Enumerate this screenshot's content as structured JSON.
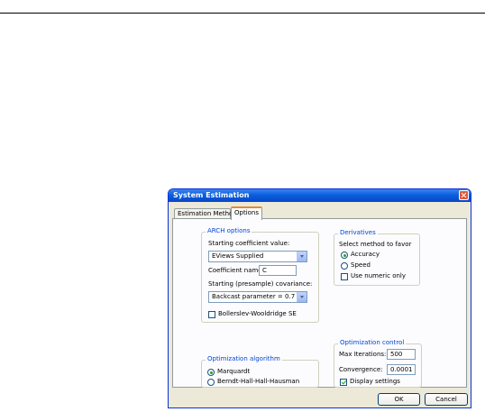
{
  "window": {
    "title": "System Estimation"
  },
  "tabs": [
    {
      "label": "Estimation Method"
    },
    {
      "label": "Options"
    }
  ],
  "arch": {
    "legend": "ARCH options",
    "start_coef_label": "Starting coefficient value:",
    "start_coef_value": "EViews Supplied",
    "coef_name_label": "Coefficient name:",
    "coef_name_value": "C",
    "start_cov_label": "Starting (presample) covariance:",
    "start_cov_value": "Backcast parameter = 0.7",
    "bw_label": "Bollerslev-Wooldridge SE"
  },
  "algorithm": {
    "legend": "Optimization algorithm",
    "options": [
      {
        "label": "Marquardt",
        "selected": true
      },
      {
        "label": "Berndt-Hall-Hall-Hausman",
        "selected": false
      }
    ]
  },
  "derivatives": {
    "legend": "Derivatives",
    "prompt": "Select method to favor",
    "options": [
      {
        "label": "Accuracy",
        "selected": true
      },
      {
        "label": "Speed",
        "selected": false
      }
    ],
    "numeric_label": "Use numeric only"
  },
  "control": {
    "legend": "Optimization control",
    "max_iter_label": "Max Iterations:",
    "max_iter_value": "500",
    "convergence_label": "Convergence:",
    "convergence_value": "0.0001",
    "display_label": "Display settings"
  },
  "buttons": {
    "ok": "OK",
    "cancel": "Cancel"
  },
  "colors": {
    "title_bar": "#0a5fdc",
    "group_legend": "#0046d5",
    "active_tab": "#e68b2c"
  }
}
